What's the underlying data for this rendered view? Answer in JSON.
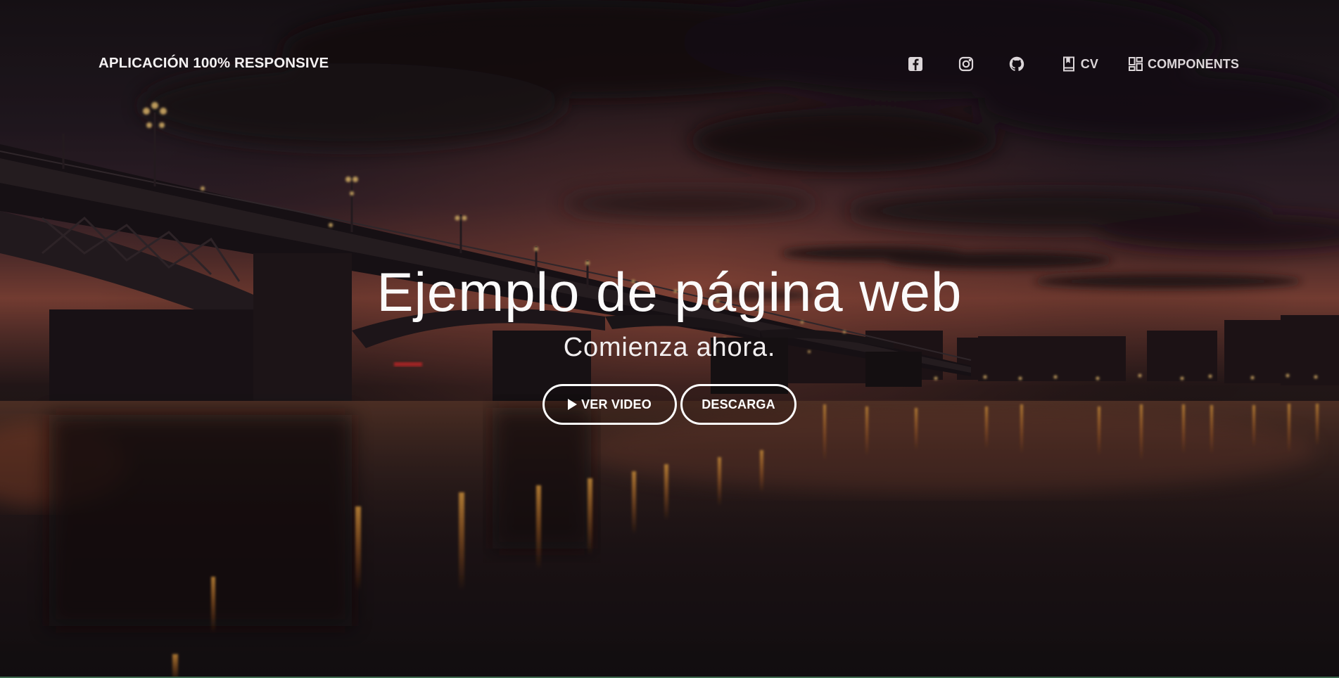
{
  "navbar": {
    "brand": "APLICACIÓN 100% RESPONSIVE",
    "links": [
      {
        "icon": "facebook-icon"
      },
      {
        "icon": "instagram-icon"
      },
      {
        "icon": "github-icon"
      },
      {
        "icon": "book-icon",
        "label": "CV"
      },
      {
        "icon": "dashboard-icon",
        "label": "COMPONENTS"
      }
    ]
  },
  "hero": {
    "title": "Ejemplo de página web",
    "subtitle": "Comienza ahora.",
    "buttons": {
      "video_label": "VER VIDEO",
      "download_label": "DESCARGA"
    }
  },
  "colors": {
    "text": "#ffffff",
    "nav_text": "#dcd6d9",
    "sky_glow": "#c0614a",
    "water_light": "#ff9a2e",
    "background": "#140f12"
  }
}
